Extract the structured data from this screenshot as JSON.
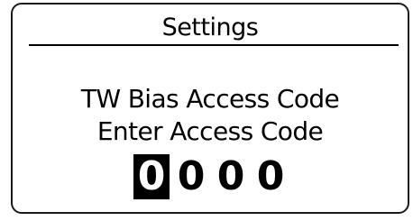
{
  "screen": {
    "title": "Settings",
    "line1": "TW Bias Access Code",
    "line2": "Enter Access Code"
  },
  "access_code": {
    "digits": [
      "0",
      "0",
      "0",
      "0"
    ],
    "selected_index": 0
  },
  "colors": {
    "background": "#ffffff",
    "foreground": "#000000",
    "selected_bg": "#000000",
    "selected_fg": "#ffffff"
  }
}
